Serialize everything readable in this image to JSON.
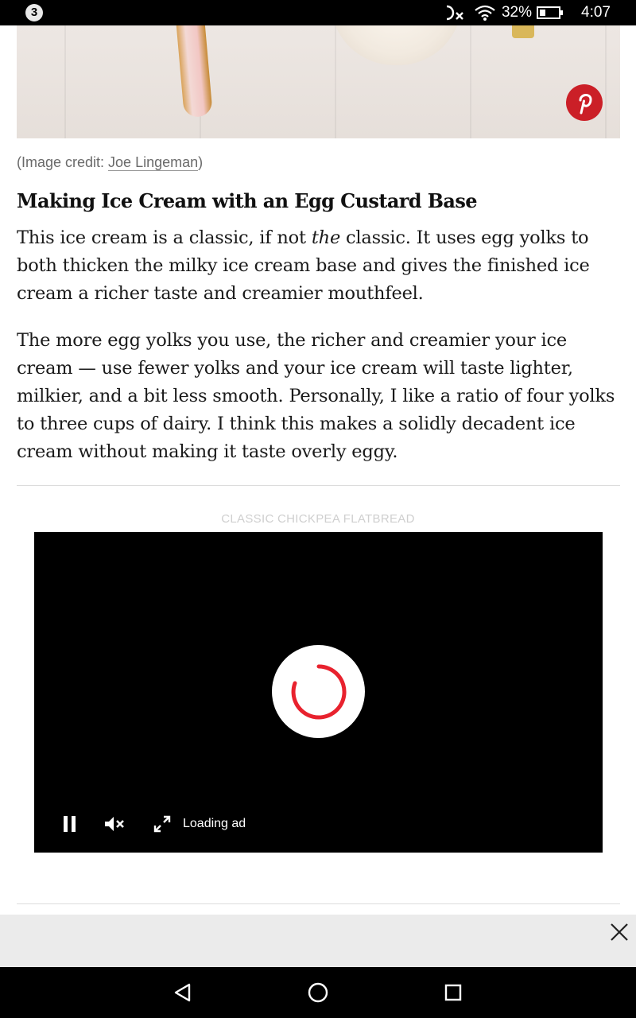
{
  "status_bar": {
    "notification_count": "3",
    "battery_percent": "32%",
    "battery_level": 0.32,
    "time": "4:07",
    "icons": [
      "no-data-icon",
      "wifi-icon",
      "battery-icon"
    ]
  },
  "hero_image": {
    "overlay_button_icon": "pinterest-icon"
  },
  "credit": {
    "prefix": "(Image credit: ",
    "name": "Joe Lingeman",
    "suffix": ")"
  },
  "article": {
    "heading": "Making Ice Cream with an Egg Custard Base",
    "p1_before": "This ice cream is a classic, if not ",
    "p1_em": "the",
    "p1_after": " classic. It uses egg yolks to both thicken the milky ice cream base and gives the finished ice cream a richer taste and creamier mouthfeel.",
    "p2": "The more egg yolks you use, the richer and creamier your ice cream — use fewer yolks and your ice cream will taste lighter, milkier, and a bit less smooth. Personally, I like a ratio of four yolks to three cups of dairy. I think this makes a solidly decadent ice cream without making it taste overly eggy."
  },
  "video": {
    "label": "CLASSIC CHICKPEA FLATBREAD",
    "status": "Loading ad",
    "controls": [
      "pause-icon",
      "mute-icon",
      "fullscreen-icon"
    ],
    "spinner_color": "#e8222e"
  },
  "ad_bar": {
    "close_icon": "close-icon"
  },
  "nav_bar": {
    "buttons": [
      "back-icon",
      "home-icon",
      "recents-icon"
    ]
  },
  "colors": {
    "pinterest": "#cb1f27",
    "status_bar": "#000000",
    "ad_bar": "#ebebeb"
  }
}
